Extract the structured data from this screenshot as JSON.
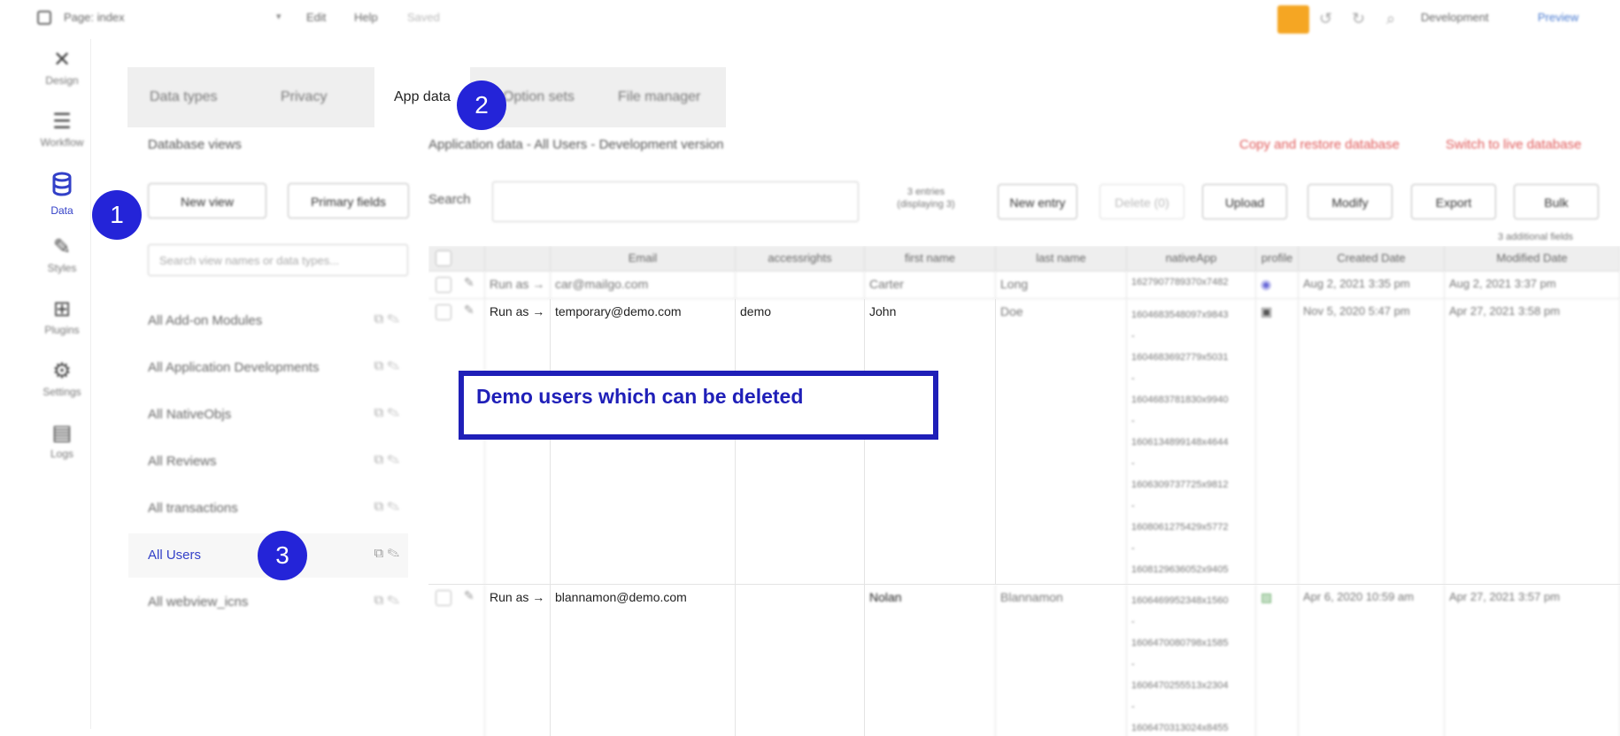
{
  "topbar": {
    "page_name": "Page: index",
    "menu_edit": "Edit",
    "menu_help": "Help",
    "status": "Saved",
    "environment": "Development",
    "preview": "Preview"
  },
  "leftnav": [
    {
      "label": "Design",
      "icon": "design-icon"
    },
    {
      "label": "Workflow",
      "icon": "workflow-icon"
    },
    {
      "label": "Data",
      "icon": "database-icon",
      "active": true
    },
    {
      "label": "Styles",
      "icon": "brush-icon"
    },
    {
      "label": "Plugins",
      "icon": "plugin-icon"
    },
    {
      "label": "Settings",
      "icon": "gear-icon"
    },
    {
      "label": "Logs",
      "icon": "document-icon"
    }
  ],
  "tabs": [
    "Data types",
    "Privacy",
    "App data",
    "Option sets",
    "File manager"
  ],
  "active_tab": "App data",
  "badges": [
    "1",
    "2",
    "3"
  ],
  "left_panel": {
    "title": "Database views",
    "new_view": "New view",
    "primary_fields": "Primary fields",
    "search_placeholder": "Search view names or data types...",
    "views": [
      "All Add-on Modules",
      "All Application Developments",
      "All NativeObjs",
      "All Reviews",
      "All transactions",
      "All Users",
      "All webview_icns"
    ],
    "active_view": "All Users"
  },
  "main": {
    "title": "Application data - All Users - Development version",
    "copy_restore": "Copy and restore database",
    "switch_live": "Switch to live database",
    "search_label": "Search",
    "entries_line1": "3 entries",
    "entries_line2": "(displaying 3)",
    "new_entry": "New entry",
    "delete": "Delete (0)",
    "upload": "Upload",
    "modify": "Modify",
    "export": "Export",
    "bulk": "Bulk",
    "additional_fields": "3 additional fields"
  },
  "table": {
    "headers": [
      "Email",
      "accessrights",
      "first name",
      "last name",
      "nativeApp",
      "profile",
      "Created Date",
      "Modified Date"
    ],
    "run_as": "Run as →",
    "rows": [
      {
        "email": "car@mailgo.com",
        "access": "",
        "first": "Carter",
        "last": "Long",
        "native": [
          "1627907789370x7482"
        ],
        "created": "Aug 2, 2021 3:35 pm",
        "modified": "Aug 2, 2021 3:37 pm"
      },
      {
        "email": "temporary@demo.com",
        "access": "demo",
        "first": "John",
        "last": "Doe",
        "native": [
          "1604683548097x9843",
          "-",
          "1604683692779x5031",
          "-",
          "1604683781830x9940",
          "-",
          "1606134899148x4644",
          "-",
          "1606309737725x9812",
          "-",
          "1608061275429x5772",
          "-",
          "1608129636052x9405"
        ],
        "created": "Nov 5, 2020 5:47 pm",
        "modified": "Apr 27, 2021 3:58 pm"
      },
      {
        "email": "blannamon@demo.com",
        "access": "",
        "first": "Nolan",
        "last": "Blannamon",
        "native": [
          "1606469952348x1560",
          "-",
          "1606470080798x1585",
          "-",
          "1606470255513x2304",
          "-",
          "1606470313024x8455"
        ],
        "created": "Apr 6, 2020 10:59 am",
        "modified": "Apr 27, 2021 3:57 pm"
      }
    ]
  },
  "annotation": "Demo users which can be deleted"
}
